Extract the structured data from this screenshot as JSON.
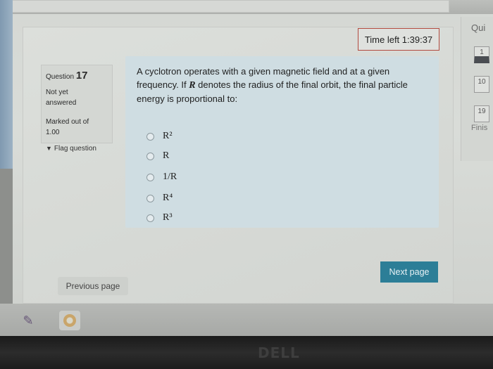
{
  "quiz": {
    "timer": "Time left 1:39:37",
    "info": {
      "question_prefix": "Question",
      "question_number": "17",
      "status": "Not yet answered",
      "marked": "Marked out of 1.00",
      "flag_label": "Flag question"
    },
    "question": {
      "text_part1": "A cyclotron operates with a given magnetic field and at a given frequency. If ",
      "symbol": "R",
      "text_part2": " denotes the radius of the final orbit, the final particle energy is proportional to:",
      "options": [
        "R²",
        "R",
        "1/R",
        "R⁴",
        "R³"
      ]
    },
    "buttons": {
      "next": "Next page",
      "previous": "Previous page"
    },
    "navigation": {
      "title": "Qui",
      "items": [
        "1",
        "10",
        "19"
      ],
      "finish": "Finis"
    }
  },
  "device": {
    "brand": "DELL"
  }
}
